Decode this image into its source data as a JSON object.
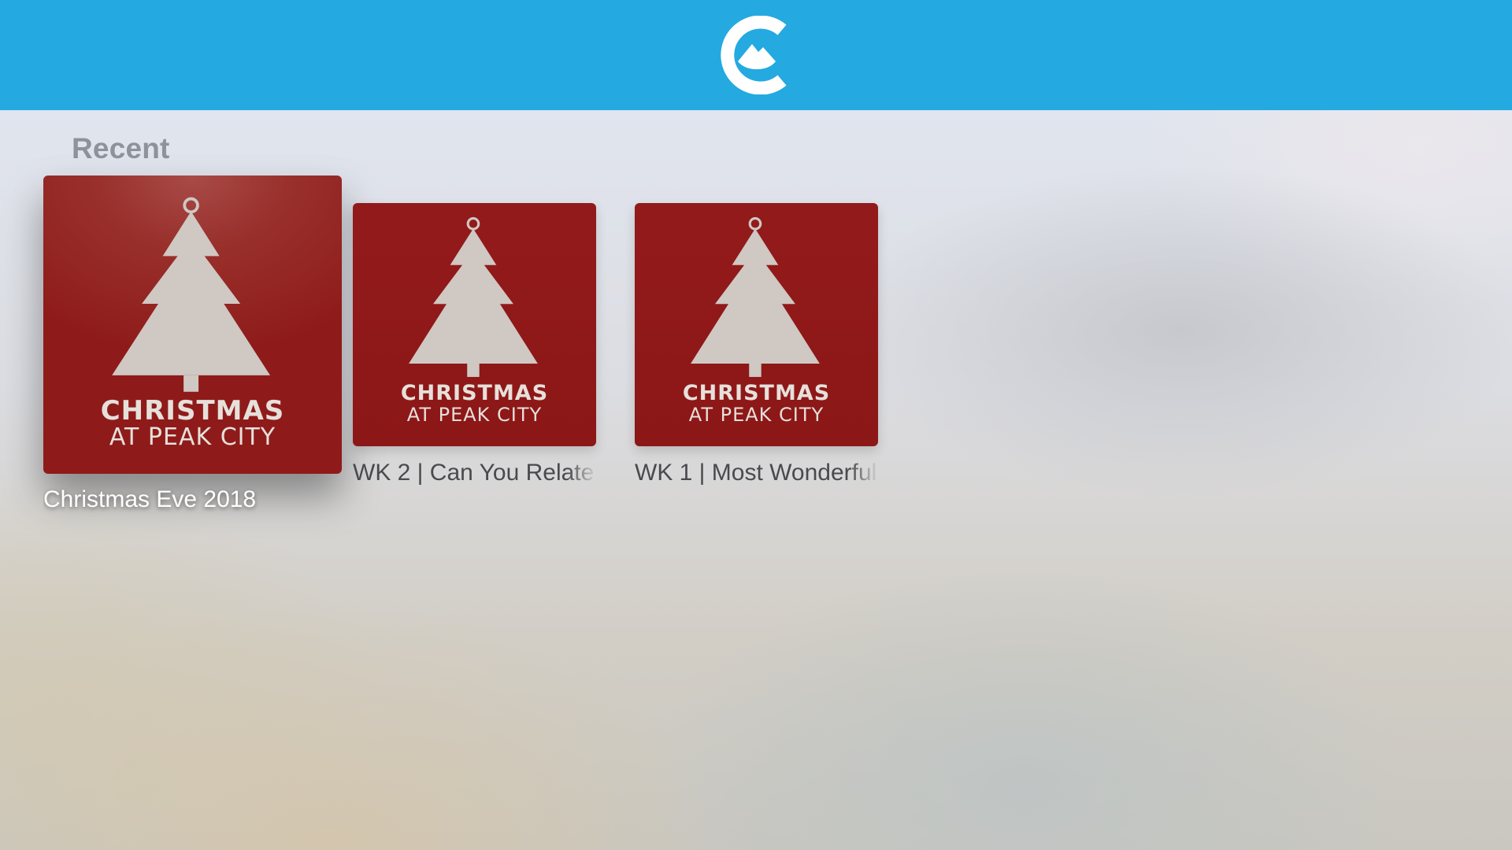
{
  "header": {
    "logo_icon": "peak-city-c-logo",
    "brand_color": "#24a9e1"
  },
  "section": {
    "title": "Recent"
  },
  "items": [
    {
      "title": "Christmas Eve 2018",
      "poster_line1": "CHRISTMAS",
      "poster_line2": "AT PEAK CITY",
      "focused": true
    },
    {
      "title": "WK 2 | Can You Relate",
      "poster_line1": "CHRISTMAS",
      "poster_line2": "AT PEAK CITY",
      "focused": false
    },
    {
      "title": "WK 1 | Most Wonderful",
      "poster_line1": "CHRISTMAS",
      "poster_line2": "AT PEAK CITY",
      "focused": false
    }
  ],
  "colors": {
    "poster_red": "#8e1b1a",
    "tree": "#cfc8c3"
  }
}
